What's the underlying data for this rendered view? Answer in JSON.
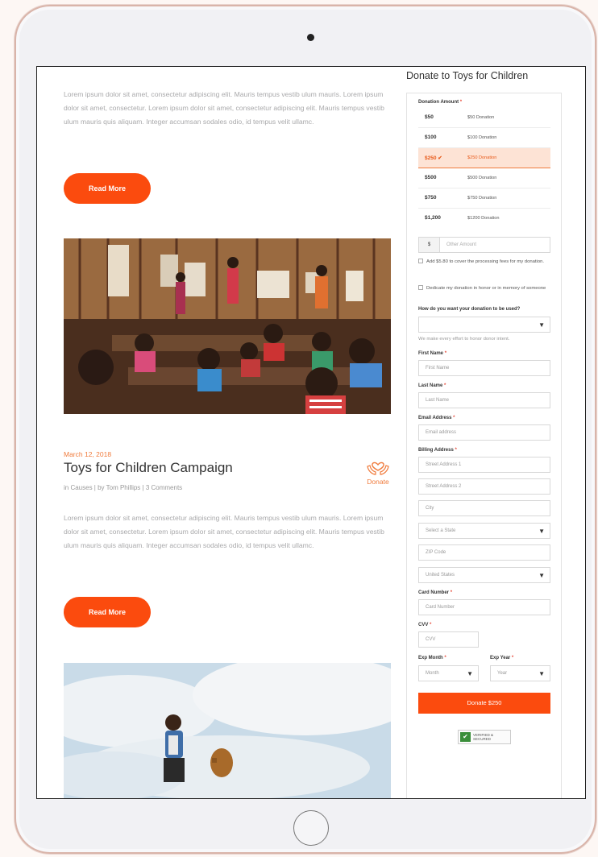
{
  "blog": {
    "post1_excerpt": "Lorem ipsum dolor sit amet, consectetur adipiscing elit. Mauris tempus vestib ulum mauris. Lorem ipsum dolor sit amet, consectetur. Lorem ipsum dolor sit amet, consectetur adipiscing elit. Mauris tempus vestib ulum mauris quis aliquam. Integer accumsan sodales odio, id tempus velit ullamc.",
    "read_more_label": "Read More",
    "post2": {
      "date": "March 12, 2018",
      "title": "Toys for Children Campaign",
      "meta": "in Causes  |  by Tom Phillips  |  3 Comments",
      "donate_label": "Donate",
      "excerpt": "Lorem ipsum dolor sit amet, consectetur adipiscing elit. Mauris tempus vestib ulum mauris. Lorem ipsum dolor sit amet, consectetur. Lorem ipsum dolor sit amet, consectetur adipiscing elit. Mauris tempus vestib ulum mauris quis aliquam. Integer accumsan sodales odio, id tempus velit ullamc."
    }
  },
  "donate_form": {
    "title": "Donate to Toys for Children",
    "amount_label": "Donation Amount",
    "required_mark": "*",
    "amounts": [
      {
        "value": "$50",
        "desc": "$50 Donation"
      },
      {
        "value": "$100",
        "desc": "$100 Donation"
      },
      {
        "value": "$250 ✔",
        "desc": "$250 Donation"
      },
      {
        "value": "$500",
        "desc": "$500 Donation"
      },
      {
        "value": "$750",
        "desc": "$750 Donation"
      },
      {
        "value": "$1,200",
        "desc": "$1200 Donation"
      }
    ],
    "currency_symbol": "$",
    "other_amount_placeholder": "Other Amount",
    "fee_checkbox": "Add $5.80 to cover the processing fees for my donation.",
    "dedicate_checkbox": "Dedicate my donation in honor or in memory of someone",
    "usage_question": "How do you want your donation to be used?",
    "usage_hint": "We make every effort to honor donor intent.",
    "first_name_label": "First Name",
    "first_name_placeholder": "First Name",
    "last_name_label": "Last Name",
    "last_name_placeholder": "Last Name",
    "email_label": "Email Address",
    "email_placeholder": "Email address",
    "billing_label": "Billing Address",
    "street1_placeholder": "Street Address 1",
    "street2_placeholder": "Street Address 2",
    "city_placeholder": "City",
    "state_placeholder": "Select a State",
    "zip_placeholder": "ZIP Code",
    "country_value": "United States",
    "card_label": "Card Number",
    "card_placeholder": "Card Number",
    "cvv_label": "CVV",
    "cvv_placeholder": "CVV",
    "exp_month_label": "Exp Month",
    "exp_month_value": "Month",
    "exp_year_label": "Exp Year",
    "exp_year_value": "Year",
    "submit_label": "Donate $250",
    "badge_text": "VERIFIED & SECURED"
  }
}
